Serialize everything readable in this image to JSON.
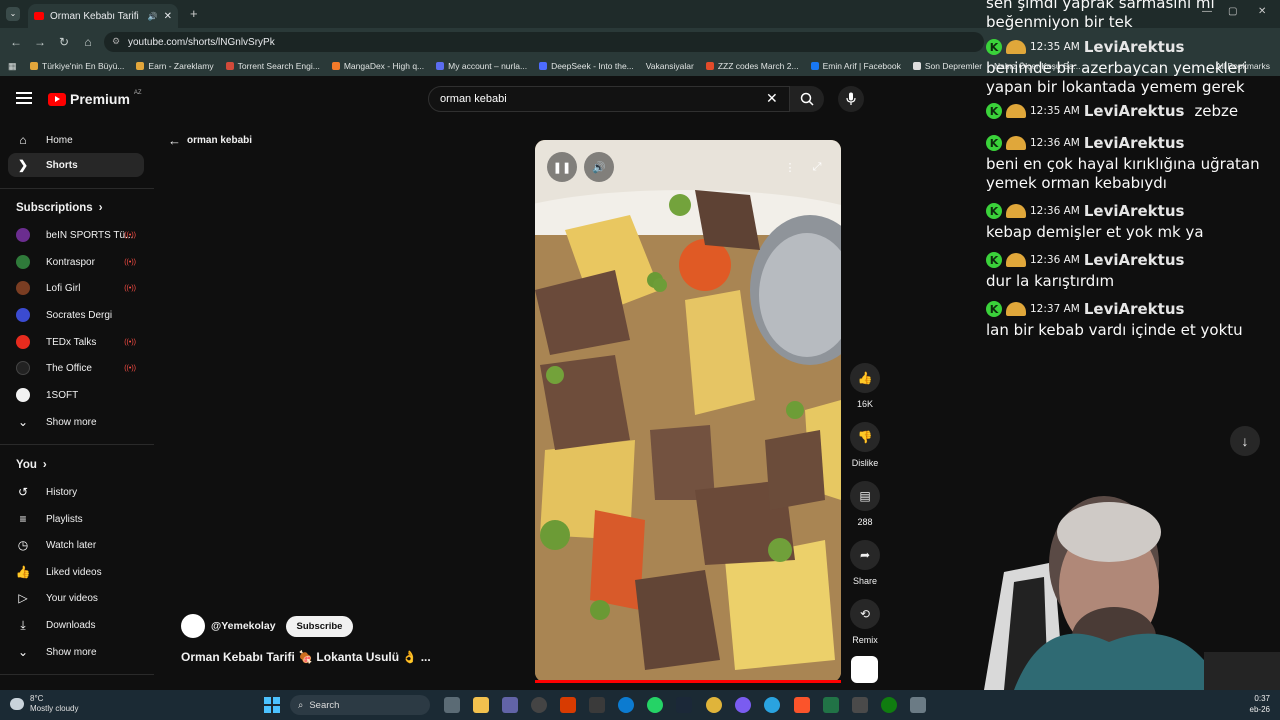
{
  "browser": {
    "tab_title": "Orman Kebabı Tarifi 🍖 Lok",
    "url": "youtube.com/shorts/lNGnlvSryPk",
    "bookmarks": [
      "Türkiye'nin En Büyü...",
      "Earn - Zareklamy",
      "Torrent Search Engi...",
      "MangaDex - High q...",
      "My account – nurla...",
      "DeepSeek - Into the...",
      "Vakansiyalar",
      "ZZZ codes March 2...",
      "Emin Arif | Facebook",
      "Son Depremler",
      "Nabız Ölçer Koşu Sa..."
    ],
    "all_bookmarks": "All Bookmarks"
  },
  "header": {
    "logo_text": "Premium",
    "logo_sup": "AZ",
    "search_value": "orman kebabi"
  },
  "sidebar": {
    "home": "Home",
    "shorts": "Shorts",
    "subscriptions_heading": "Subscriptions",
    "subscriptions": [
      {
        "name": "beIN SPORTS Tü...",
        "color": "#6b2d8f"
      },
      {
        "name": "Kontraspor",
        "color": "#2f7a3a"
      },
      {
        "name": "Lofi Girl",
        "color": "#7a3d22"
      },
      {
        "name": "Socrates Dergi",
        "color": "#3b4bd1"
      },
      {
        "name": "TEDx Talks",
        "color": "#e62b1e"
      },
      {
        "name": "The Office",
        "color": "#222222"
      },
      {
        "name": "1SOFT",
        "color": "#f2f2f2"
      }
    ],
    "show_more_1": "Show more",
    "you_heading": "You",
    "you_items": [
      "History",
      "Playlists",
      "Watch later",
      "Liked videos",
      "Your videos",
      "Downloads"
    ],
    "show_more_2": "Show more"
  },
  "shorts": {
    "query": "orman kebabi",
    "channel": "@Yemekolay",
    "subscribe": "Subscribe",
    "title": "Orman Kebabı Tarifi 🍖 Lokanta Usulü 👌 ...",
    "likes": "16K",
    "dislike": "Dislike",
    "comments": "288",
    "share": "Share",
    "remix": "Remix"
  },
  "chat": {
    "top_text": "sen şimdi yaprak sarmasını mı beğenmiyon bir tek",
    "messages": [
      {
        "time": "12:35 AM",
        "user": "LeviArektus",
        "text": "benimde bir azerbaycan yemekleri yapan bir lokantada yemem gerek"
      },
      {
        "time": "12:35 AM",
        "user": "LeviArektus",
        "text": "zebze"
      },
      {
        "time": "12:36 AM",
        "user": "LeviArektus",
        "text": "beni en çok hayal kırıklığına uğratan yemek orman kebabıydı"
      },
      {
        "time": "12:36 AM",
        "user": "LeviArektus",
        "text": "kebap demişler et yok mk ya"
      },
      {
        "time": "12:36 AM",
        "user": "LeviArektus",
        "text": "dur la karıştırdım"
      },
      {
        "time": "12:37 AM",
        "user": "LeviArektus",
        "text": "lan bir kebab vardı içinde et yoktu"
      }
    ]
  },
  "taskbar": {
    "temp": "8°C",
    "weather": "Mostly cloudy",
    "search": "Search",
    "time": "0:37",
    "date": "eb-26"
  }
}
